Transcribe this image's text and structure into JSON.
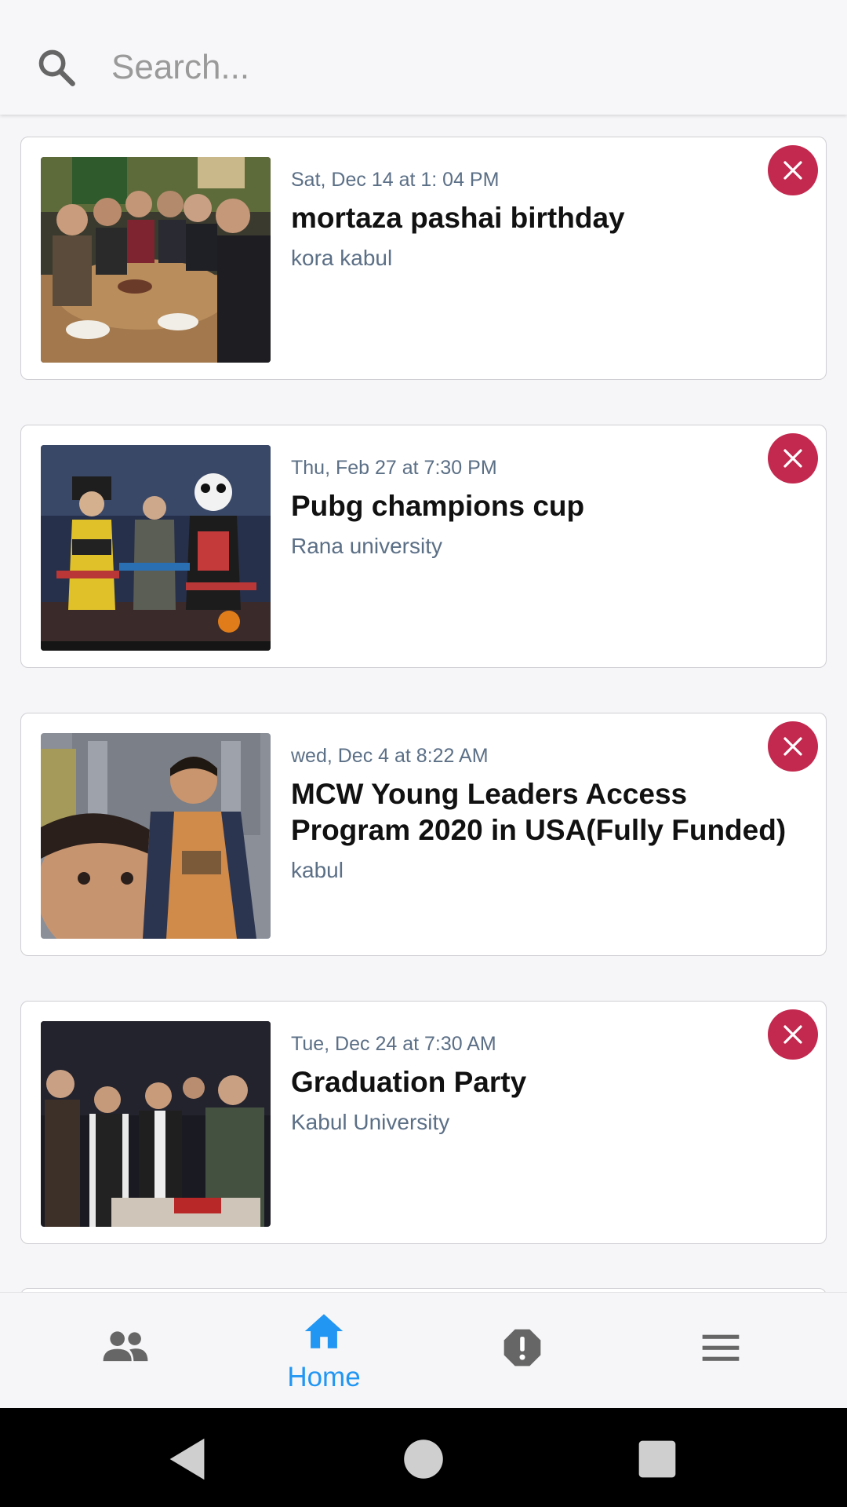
{
  "search": {
    "placeholder": "Search..."
  },
  "events": [
    {
      "date": "Sat, Dec 14 at 1: 04 PM",
      "title": "mortaza pashai birthday",
      "location": "kora kabul",
      "image": "group-dinner-photo"
    },
    {
      "date": "Thu, Feb 27 at 7:30 PM",
      "title": "Pubg champions cup",
      "location": "Rana university",
      "image": "game-lobby-screenshot"
    },
    {
      "date": "wed, Dec 4 at 8:22 AM",
      "title": "MCW Young Leaders Access Program 2020 in USA(Fully Funded)",
      "location": "kabul",
      "image": "selfie-photo"
    },
    {
      "date": "Tue, Dec 24 at 7:30 AM",
      "title": "Graduation Party",
      "location": "Kabul University",
      "image": "group-party-photo"
    }
  ],
  "bottom_nav": {
    "items": [
      {
        "icon": "people-icon",
        "label": ""
      },
      {
        "icon": "home-icon",
        "label": "Home",
        "active": true
      },
      {
        "icon": "alert-icon",
        "label": ""
      },
      {
        "icon": "menu-icon",
        "label": ""
      }
    ]
  },
  "colors": {
    "accent": "#2196f3",
    "delete": "#c3294f",
    "muted_text": "#5b6f86"
  }
}
